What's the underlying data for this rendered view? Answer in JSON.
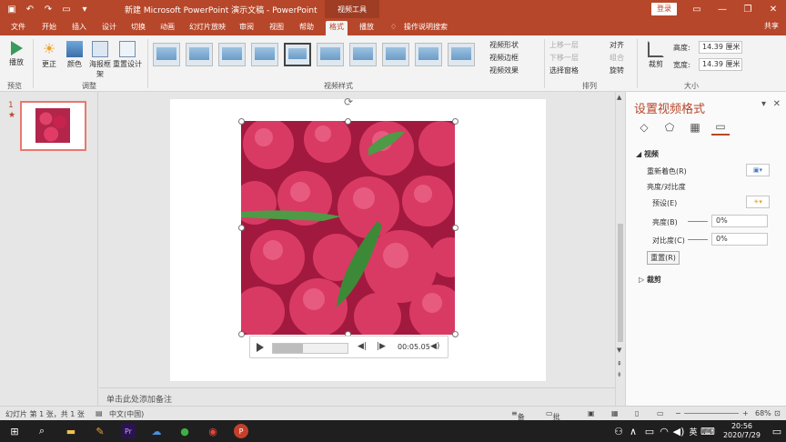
{
  "titlebar": {
    "title": "新建 Microsoft PowerPoint 演示文稿 - PowerPoint",
    "tool_tab": "视频工具",
    "login": "登录",
    "qat_icons": [
      "save-icon",
      "undo-icon",
      "redo-icon",
      "present-icon"
    ]
  },
  "tabs": [
    "文件",
    "开始",
    "插入",
    "设计",
    "切换",
    "动画",
    "幻灯片放映",
    "审阅",
    "视图",
    "帮助",
    "格式",
    "播放"
  ],
  "active_tab": "格式",
  "tellme": "操作说明搜索",
  "share": "共享",
  "ribbon": {
    "play": "播放",
    "correct": "更正",
    "color": "颜色",
    "poster": "海报框架",
    "reset_design": "重置设计",
    "group_preview": "预览",
    "group_adjust": "调整",
    "group_styles": "视频样式",
    "video_shape": "视频形状",
    "video_border": "视频边框",
    "video_effects": "视频效果",
    "bring_forward": "上移一层",
    "send_backward": "下移一层",
    "selection_pane": "选择窗格",
    "align": "对齐",
    "group": "组合",
    "rotate": "旋转",
    "group_arrange": "排列",
    "crop": "裁剪",
    "height_label": "高度:",
    "height_value": "14.39 厘米",
    "width_label": "宽度:",
    "width_value": "14.39 厘米",
    "group_size": "大小"
  },
  "slides": {
    "number": "1",
    "star": "★"
  },
  "video": {
    "time": "00:05.05",
    "progress": 0.4
  },
  "notes_placeholder": "单击此处添加备注",
  "format_pane": {
    "title": "设置视频格式",
    "section_video": "视频",
    "recolor": "重新着色(R)",
    "brightness_contrast": "亮度/对比度",
    "preset": "预设(E)",
    "brightness": "亮度(B)",
    "brightness_value": "0%",
    "contrast": "对比度(C)",
    "contrast_value": "0%",
    "reset": "重置(R)",
    "section_crop": "裁剪"
  },
  "status": {
    "slide_info": "幻灯片 第 1 张，共 1 张",
    "language": "中文(中国)",
    "notes": "备注",
    "comments": "批注",
    "zoom": "68%"
  },
  "taskbar": {
    "time": "20:56",
    "date": "2020/7/29",
    "ime": "英"
  }
}
